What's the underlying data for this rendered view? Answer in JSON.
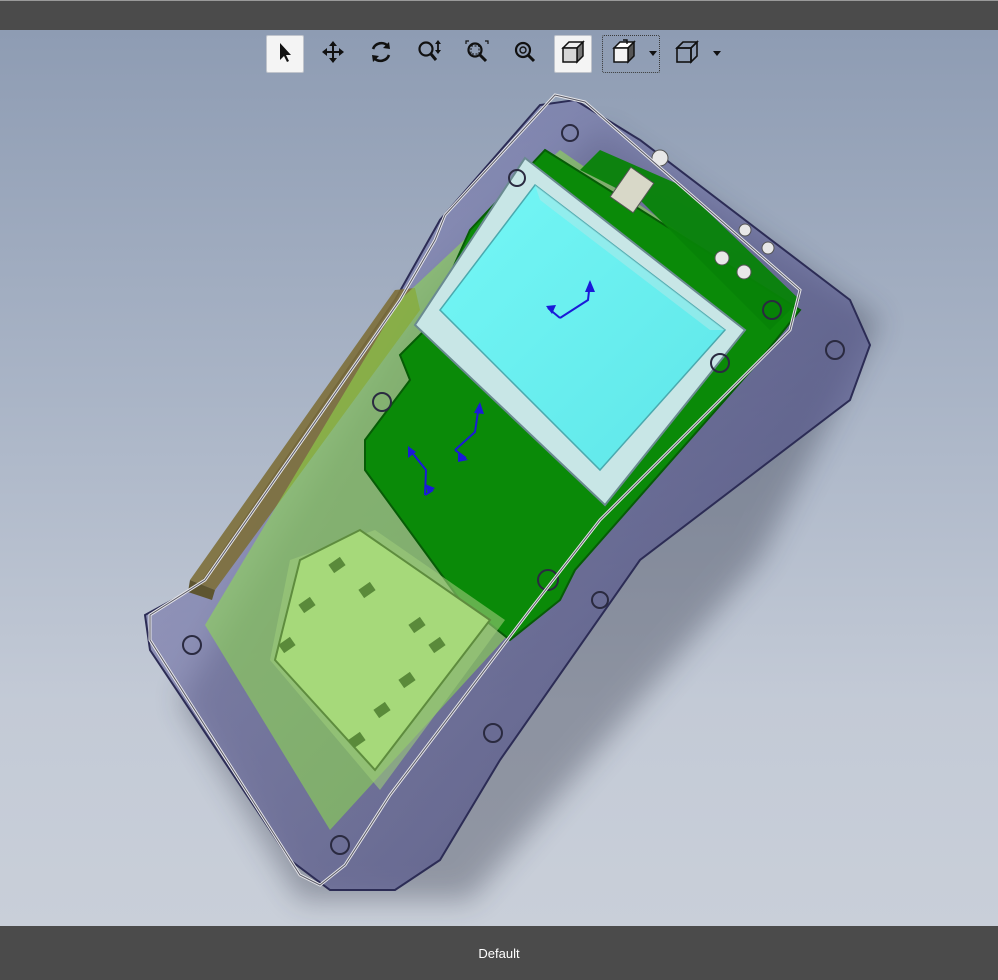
{
  "status_bar": {
    "configuration_name": "Default"
  },
  "toolbar": {
    "items": [
      {
        "name": "select",
        "icon": "arrow-pointer-icon",
        "active": true
      },
      {
        "name": "pan",
        "icon": "move-arrows-icon"
      },
      {
        "name": "rotate",
        "icon": "rotate-view-icon"
      },
      {
        "name": "zoom-in-out",
        "icon": "zoom-in-out-icon"
      },
      {
        "name": "zoom-to-area",
        "icon": "zoom-to-area-icon"
      },
      {
        "name": "zoom-to-fit",
        "icon": "zoom-to-fit-icon"
      },
      {
        "name": "display-style",
        "icon": "shaded-cube-icon",
        "active": true
      },
      {
        "name": "view-orientation",
        "icon": "view-orientation-icon",
        "has_dropdown": true
      },
      {
        "name": "hide-show-items",
        "icon": "wireframe-cube-icon",
        "has_dropdown": true
      }
    ]
  },
  "colors": {
    "viewport_top": "#8e9cb3",
    "viewport_bottom": "#c9cfd9",
    "pcb": "#0a8a08",
    "lcd": "#6ff3f2",
    "enclosure": "#5a5a9a",
    "battery": "#a6d97a"
  }
}
